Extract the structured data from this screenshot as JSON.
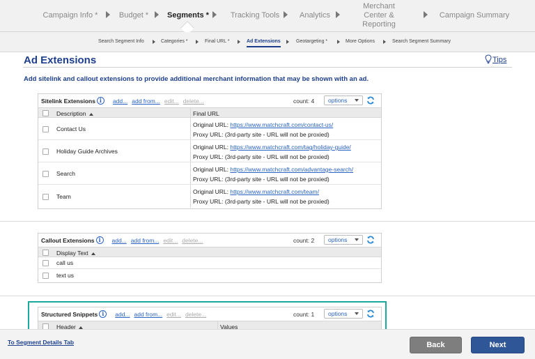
{
  "wizard": {
    "steps": [
      {
        "label": "Campaign Info *"
      },
      {
        "label": "Budget *"
      },
      {
        "label": "Segments *"
      },
      {
        "label": "Tracking Tools"
      },
      {
        "label": "Analytics"
      },
      {
        "label": "Merchant Center & Reporting"
      },
      {
        "label": "Campaign Summary"
      }
    ],
    "sub_steps": [
      {
        "label": "Search Segment Info"
      },
      {
        "label": "Categories *"
      },
      {
        "label": "Final URL *"
      },
      {
        "label": "Ad Extensions"
      },
      {
        "label": "Geotargeting *"
      },
      {
        "label": "More Options"
      },
      {
        "label": "Search Segment Summary"
      }
    ]
  },
  "page": {
    "title": "Ad Extensions",
    "tips_label": "Tips",
    "subtitle": "Add sitelink and callout extensions to provide additional merchant information that may be shown with an ad."
  },
  "sitelink": {
    "name": "Sitelink Extensions",
    "add": "add...",
    "add_from": "add from...",
    "edit": "edit...",
    "delete": "delete...",
    "count": "count: 4",
    "options": "options",
    "col_description": "Description",
    "col_final_url": "Final URL",
    "original_label": "Original URL:",
    "proxy_label": "Proxy URL:",
    "rows": [
      {
        "description": "Contact Us",
        "original_url": "https://www.matchcraft.com/contact-us/",
        "proxy": "(3rd-party site - URL will not be proxied)"
      },
      {
        "description": "Holiday Guide Archives",
        "original_url": "https://www.matchcraft.com/tag/holiday-guide/",
        "proxy": "(3rd-party site - URL will not be proxied)"
      },
      {
        "description": "Search",
        "original_url": "https://www.matchcraft.com/advantage-search/",
        "proxy": "(3rd-party site - URL will not be proxied)"
      },
      {
        "description": "Team",
        "original_url": "https://www.matchcraft.com/team/",
        "proxy": "(3rd-party site - URL will not be proxied)"
      }
    ]
  },
  "callout": {
    "name": "Callout Extensions",
    "add": "add...",
    "add_from": "add from...",
    "edit": "edit...",
    "delete": "delete...",
    "count": "count: 2",
    "options": "options",
    "col_display_text": "Display Text",
    "rows": [
      {
        "text": "call us"
      },
      {
        "text": "text us"
      }
    ]
  },
  "snippets": {
    "name": "Structured Snippets",
    "add": "add...",
    "add_from": "add from...",
    "edit": "edit...",
    "delete": "delete...",
    "count": "count: 1",
    "options": "options",
    "col_header": "Header",
    "col_values": "Values"
  },
  "footer": {
    "back_link": "To Segment Details Tab",
    "back_button": "Back",
    "next_button": "Next"
  },
  "colors": {
    "heading_blue": "#1d3f8e",
    "link_blue": "#2a63c4",
    "highlight_teal": "#1aa99c",
    "next_blue": "#2f5797",
    "back_gray": "#7e7e7e"
  },
  "icons": [
    "info-icon",
    "refresh-icon",
    "lightbulb-icon",
    "sort-ascending-icon",
    "dropdown-caret-icon"
  ]
}
